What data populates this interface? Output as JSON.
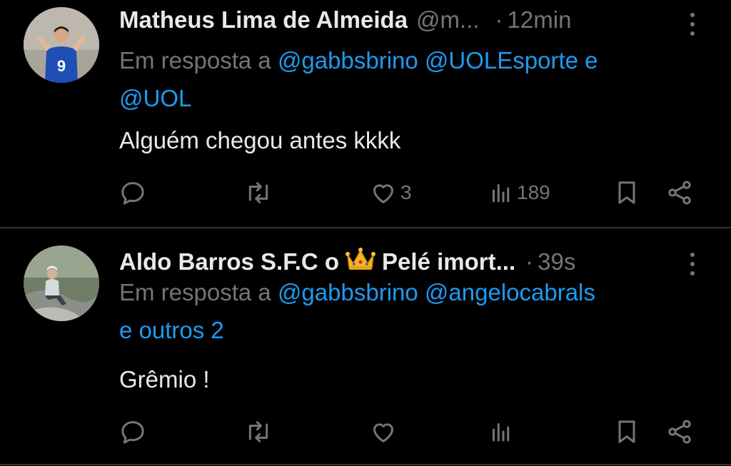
{
  "tweets": [
    {
      "name": "Matheus Lima de Almeida",
      "handle": "@m...",
      "separator": "·",
      "time": "12min",
      "reply_prefix": "Em resposta a",
      "mentions": [
        "@gabbsbrino",
        "@UOLEsporte",
        "e",
        "@UOL"
      ],
      "text": "Alguém chegou antes kkkk",
      "likes": "3",
      "views": "189",
      "avatar_jersey_number": "9"
    },
    {
      "name_part1": "Aldo Barros S.F.C o",
      "name_part2": "Pelé imort...",
      "separator": "·",
      "time": "39s",
      "reply_prefix": "Em resposta a",
      "mentions": [
        "@gabbsbrino",
        "@angelocabrals",
        "e outros 2"
      ],
      "text": "Grêmio  !",
      "likes": "",
      "views": ""
    }
  ],
  "icons": [
    "reply-icon",
    "retweet-icon",
    "like-icon",
    "views-icon",
    "bookmark-icon",
    "share-icon",
    "more-icon",
    "crown-emoji"
  ],
  "colors": {
    "background": "#000000",
    "text": "#e7e9ea",
    "secondary": "#71767b",
    "link": "#1d9bf0",
    "divider": "#2f3336"
  }
}
